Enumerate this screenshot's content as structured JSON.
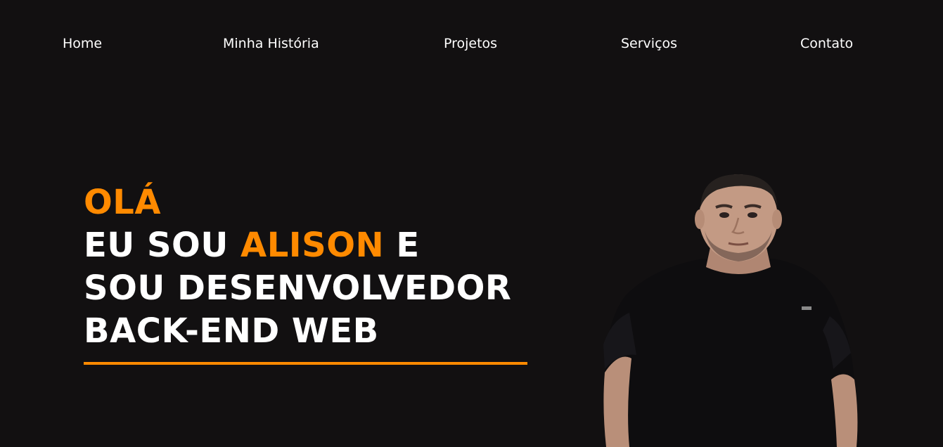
{
  "nav": {
    "items": [
      {
        "label": "Home"
      },
      {
        "label": "Minha História"
      },
      {
        "label": "Projetos"
      },
      {
        "label": "Serviços"
      },
      {
        "label": "Contato"
      }
    ]
  },
  "hero": {
    "greeting": "OLÁ",
    "line2_prefix": "EU SOU",
    "name": "ALISON",
    "line2_suffix": "E",
    "line3": "SOU DESENVOLVEDOR",
    "line4": "BACK-END WEB"
  },
  "colors": {
    "background": "#121011",
    "accent": "#ff8a00",
    "text": "#ffffff"
  }
}
